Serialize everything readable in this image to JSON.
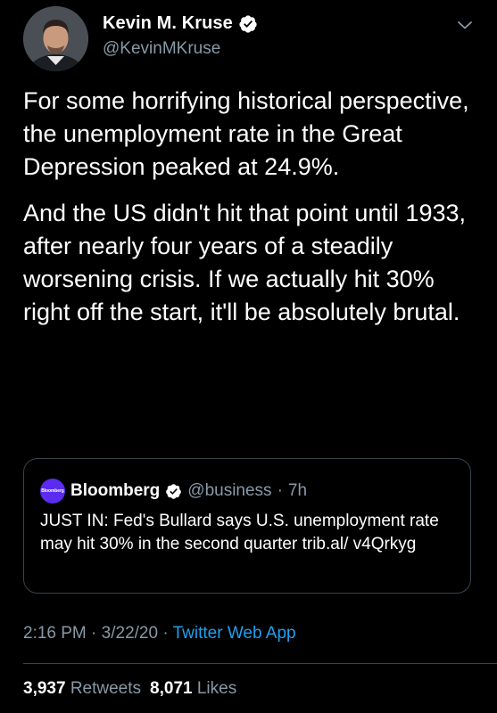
{
  "author": {
    "display_name": "Kevin M. Kruse",
    "handle": "@KevinMKruse",
    "avatar_icon": "profile-photo"
  },
  "tweet": {
    "paragraphs": [
      "For some horrifying historical perspective, the unemployment rate in the Great Depression peaked at 24.9%.",
      "And the US didn't hit that point until 1933, after nearly four years of a steadily worsening crisis. If we actually hit 30% right off the start, it'll be absolutely brutal."
    ],
    "time": "2:16 PM",
    "date": "3/22/20",
    "separator": "·",
    "source": "Twitter Web App"
  },
  "quoted": {
    "avatar_text": "Bloomberg",
    "name": "Bloomberg",
    "handle": "@business",
    "separator": "·",
    "time": "7h",
    "text": "JUST IN: Fed's Bullard says U.S. unemployment rate may hit 30% in the second quarter trib.al/ v4Qrkyg"
  },
  "stats": {
    "retweets_count": "3,937",
    "retweets_label": "Retweets",
    "likes_count": "8,071",
    "likes_label": "Likes"
  },
  "colors": {
    "background": "#000000",
    "text": "#ffffff",
    "secondary": "#8899a6",
    "link": "#1da1f2",
    "border": "#38444d",
    "verified": "#ffffff",
    "bloomberg": "#5b2bf0"
  }
}
